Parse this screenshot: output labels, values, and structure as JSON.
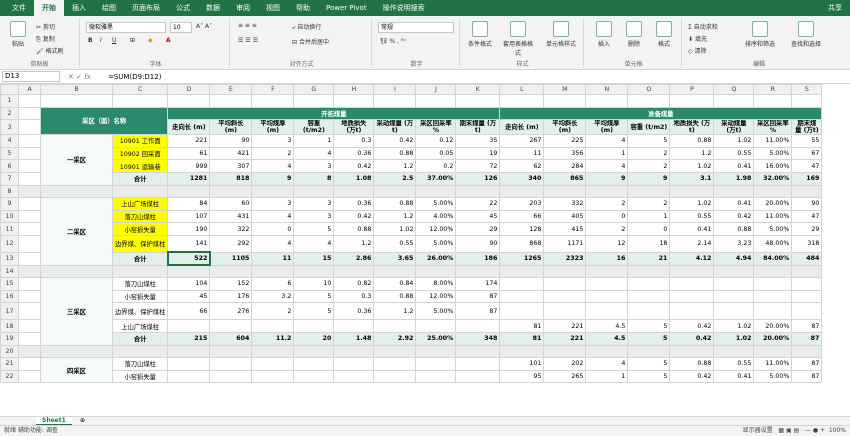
{
  "ribbon": {
    "tabs": [
      "文件",
      "开始",
      "插入",
      "绘图",
      "页面布局",
      "公式",
      "数据",
      "审阅",
      "视图",
      "帮助",
      "Power Pivot",
      "操作说明搜索",
      "共享"
    ],
    "clipboard": [
      "剪切",
      "复制",
      "格式刷",
      "粘贴",
      "剪贴板"
    ],
    "font": {
      "name": "微软雅黑",
      "size": "10",
      "label": "字体"
    },
    "align": {
      "wrap": "自动换行",
      "merge": "合并后居中",
      "label": "对齐方式"
    },
    "number": {
      "format": "常规",
      "label": "数字"
    },
    "styles": [
      "条件格式",
      "套用表格格式",
      "单元格样式",
      "样式"
    ],
    "cells": [
      "插入",
      "删除",
      "格式",
      "单元格"
    ],
    "edit": [
      "自动求和",
      "填充",
      "清除",
      "排序和筛选",
      "查找和选择",
      "编辑"
    ]
  },
  "formula_bar": {
    "name_box": "D13",
    "fx": "fx",
    "formula": "=SUM(D9:D12)"
  },
  "columns": [
    "A",
    "B",
    "C",
    "D",
    "E",
    "F",
    "G",
    "H",
    "I",
    "J",
    "K",
    "L",
    "M",
    "N",
    "O",
    "P",
    "Q",
    "R",
    "S"
  ],
  "headers": {
    "area": "采区（面）名称",
    "mining": "开拓煤量",
    "prep": "准备煤量",
    "cols": [
      "走向长 (m)",
      "平均斜长 (m)",
      "平均煤厚 (m)",
      "容重 (t/m2)",
      "地质损失 (万t)",
      "采动煤量 (万t)",
      "采区回采率 %",
      "期末煤量 (万t)",
      "走向长 (m)",
      "平均斜长 (m)",
      "平均煤厚 (m)",
      "容重 (t/m2)",
      "地质损失 (万t)",
      "采动煤量 (万t)",
      "采区回采率 %",
      "期末煤量 (万t)"
    ]
  },
  "rows": [
    {
      "r": "4",
      "area": "一采区",
      "name": "10901 工作面",
      "v": [
        "221",
        "90",
        "3",
        "1",
        "0.3",
        "0.42",
        "0.12",
        "35",
        "267",
        "225",
        "4",
        "5",
        "0.88",
        "1.02",
        "11.00%",
        "55"
      ]
    },
    {
      "r": "5",
      "name": "10902 回采面",
      "v": [
        "61",
        "421",
        "2",
        "4",
        "0.36",
        "0.88",
        "0.05",
        "19",
        "11",
        "356",
        "1",
        "2",
        "1.2",
        "0.55",
        "5.00%",
        "67"
      ]
    },
    {
      "r": "6",
      "name": "10901 运输巷",
      "v": [
        "999",
        "307",
        "4",
        "3",
        "0.42",
        "1.2",
        "0.2",
        "72",
        "62",
        "284",
        "4",
        "2",
        "1.02",
        "0.41",
        "16.00%",
        "47"
      ]
    },
    {
      "r": "7",
      "name": "合计",
      "v": [
        "1281",
        "818",
        "9",
        "8",
        "1.08",
        "2.5",
        "37.00%",
        "126",
        "340",
        "865",
        "9",
        "9",
        "3.1",
        "1.98",
        "32.00%",
        "169"
      ]
    },
    {
      "r": "9",
      "area": "二采区",
      "name": "上山广场煤柱",
      "v": [
        "84",
        "60",
        "3",
        "3",
        "0.36",
        "0.88",
        "5.00%",
        "22",
        "203",
        "332",
        "2",
        "2",
        "1.02",
        "0.41",
        "20.00%",
        "90"
      ]
    },
    {
      "r": "10",
      "name": "落刀山煤柱",
      "v": [
        "107",
        "431",
        "4",
        "3",
        "0.42",
        "1.2",
        "4.00%",
        "45",
        "66",
        "405",
        "0",
        "1",
        "0.55",
        "0.42",
        "11.00%",
        "47"
      ]
    },
    {
      "r": "11",
      "name": "小窑损失量",
      "v": [
        "190",
        "322",
        "0",
        "5",
        "0.88",
        "1.02",
        "12.00%",
        "29",
        "128",
        "415",
        "2",
        "0",
        "0.41",
        "0.88",
        "5.00%",
        "29"
      ]
    },
    {
      "r": "12",
      "name": "边界煤、保护煤柱",
      "v": [
        "141",
        "292",
        "4",
        "4",
        "1.2",
        "0.55",
        "5.00%",
        "90",
        "868",
        "1171",
        "12",
        "18",
        "2.14",
        "3.23",
        "48.00%",
        "318"
      ]
    },
    {
      "r": "13",
      "name": "合计",
      "v": [
        "522",
        "1105",
        "11",
        "15",
        "2.86",
        "3.65",
        "26.00%",
        "186",
        "1265",
        "2323",
        "16",
        "21",
        "4.12",
        "4.94",
        "84.00%",
        "484"
      ]
    },
    {
      "r": "15",
      "area": "三采区",
      "name": "落刀山煤柱",
      "v": [
        "104",
        "152",
        "6",
        "10",
        "0.82",
        "0.84",
        "8.00%",
        "174",
        "",
        "",
        "",
        "",
        "",
        "",
        "",
        ""
      ]
    },
    {
      "r": "16",
      "name": "小窑损失量",
      "v": [
        "45",
        "176",
        "3.2",
        "5",
        "0.3",
        "0.88",
        "12.00%",
        "87",
        "",
        "",
        "",
        "",
        "",
        "",
        "",
        ""
      ]
    },
    {
      "r": "17",
      "name": "边界煤、保护煤柱",
      "v": [
        "66",
        "276",
        "2",
        "5",
        "0.36",
        "1.2",
        "5.00%",
        "87",
        "",
        "",
        "",
        "",
        "",
        "",
        "",
        ""
      ]
    },
    {
      "r": "18",
      "name": "上山广场煤柱",
      "v": [
        "",
        "",
        "",
        "",
        "",
        "",
        "",
        "",
        "81",
        "221",
        "4.5",
        "5",
        "0.42",
        "1.02",
        "20.00%",
        "87"
      ]
    },
    {
      "r": "19",
      "name": "合计",
      "v": [
        "215",
        "604",
        "11.2",
        "20",
        "1.48",
        "2.92",
        "25.00%",
        "348",
        "81",
        "221",
        "4.5",
        "5",
        "0.42",
        "1.02",
        "20.00%",
        "87"
      ]
    },
    {
      "r": "21",
      "area": "四采区",
      "name": "落刀山煤柱",
      "v": [
        "",
        "",
        "",
        "",
        "",
        "",
        "",
        "",
        "101",
        "202",
        "4",
        "5",
        "0.88",
        "0.55",
        "11.00%",
        "87"
      ]
    },
    {
      "r": "22",
      "name": "小窑损失量",
      "v": [
        "",
        "",
        "",
        "",
        "",
        "",
        "",
        "",
        "95",
        "265",
        "1",
        "5",
        "0.42",
        "0.41",
        "5.00%",
        "87"
      ]
    }
  ],
  "sheet": "Sheet1",
  "status": {
    "left": "就绪   辅助功能: 调查",
    "zoom": "100%",
    "display": "显示器设置"
  }
}
